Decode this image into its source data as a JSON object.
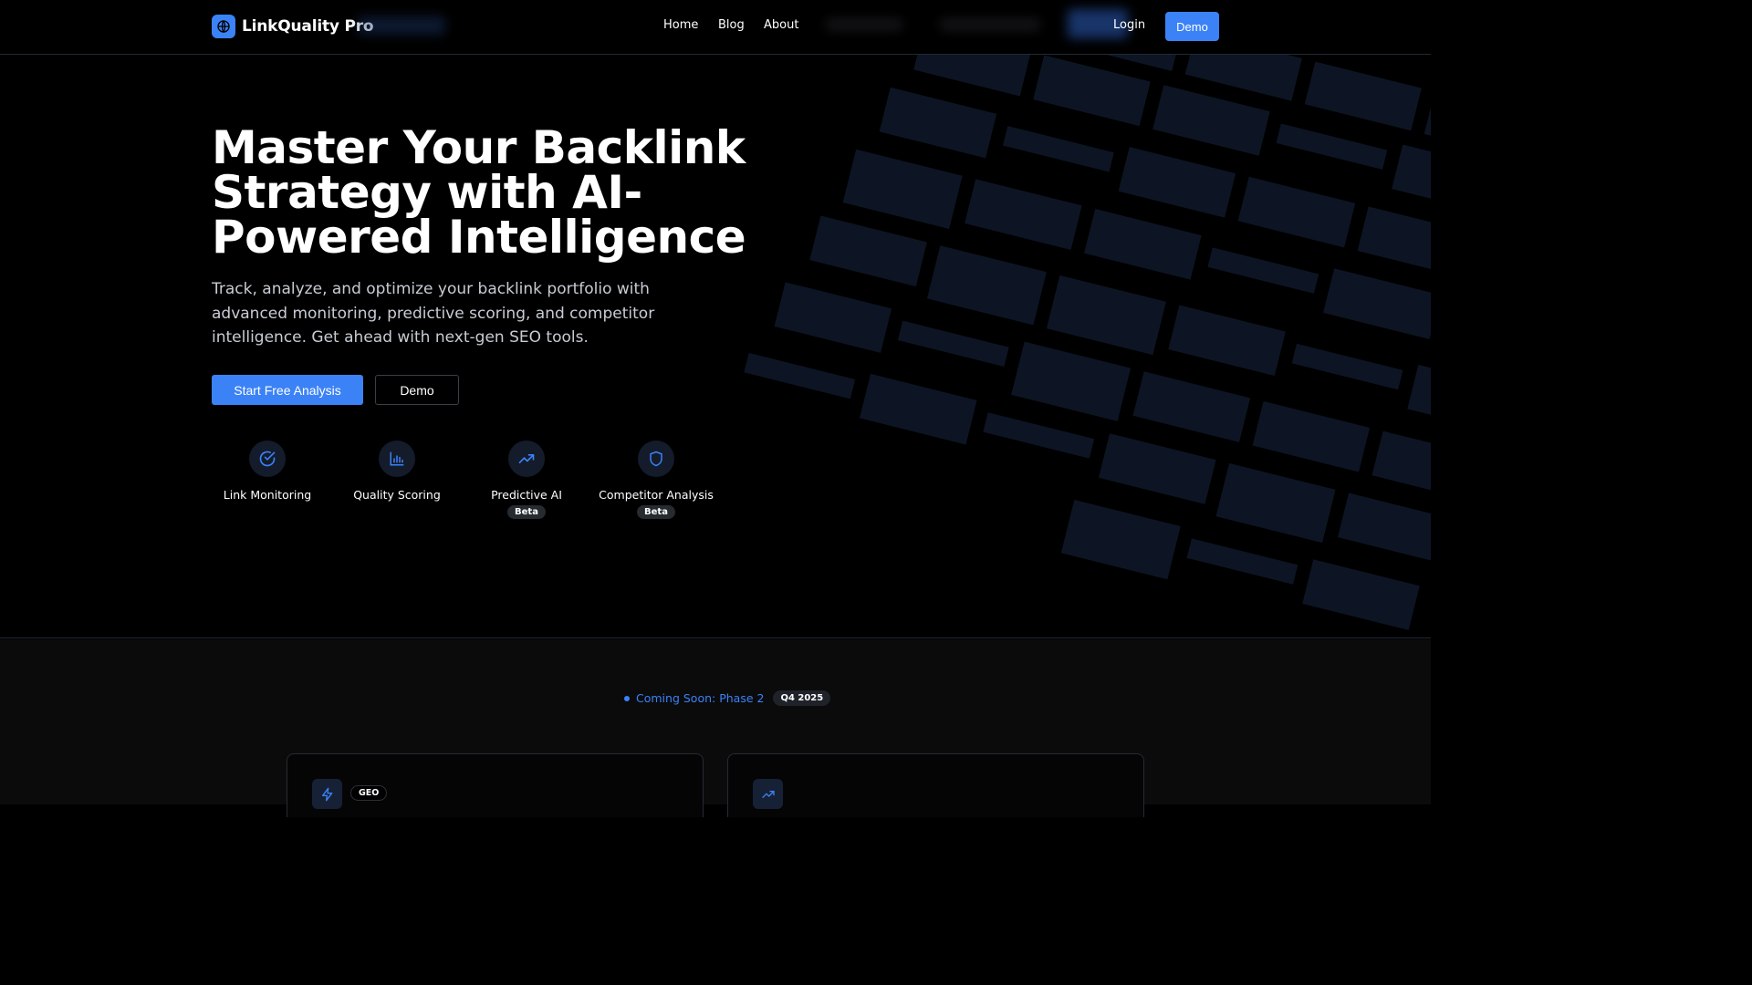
{
  "header": {
    "brand": "LinkQuality Pro",
    "nav": [
      "Home",
      "Blog",
      "About"
    ],
    "login_label": "Login",
    "demo_label": "Demo"
  },
  "hero": {
    "title_line1": "Master Your Backlink",
    "title_line2": "Strategy with AI-",
    "title_line3": "Powered Intelligence",
    "subtitle": "Track, analyze, and optimize your backlink portfolio with advanced monitoring, predictive scoring, and competitor intelligence. Get ahead with next-gen SEO tools.",
    "primary_cta": "Start Free Analysis",
    "secondary_cta": "Demo",
    "features": [
      {
        "label": "Link Monitoring",
        "icon": "check-circle-icon",
        "badge": ""
      },
      {
        "label": "Quality Scoring",
        "icon": "bar-chart-icon",
        "badge": ""
      },
      {
        "label": "Predictive AI",
        "icon": "trending-up-icon",
        "badge": "Beta"
      },
      {
        "label": "Competitor Analysis",
        "icon": "shield-icon",
        "badge": "Beta"
      }
    ]
  },
  "phase": {
    "coming_soon": "Coming Soon: Phase 2",
    "quarter": "Q4 2025",
    "cards": [
      {
        "icon": "lightning-icon",
        "badge": "GEO"
      },
      {
        "icon": "trending-up-icon",
        "badge": ""
      }
    ]
  },
  "colors": {
    "accent": "#3b82f6",
    "background": "#000000",
    "tile": "#0d1524"
  }
}
